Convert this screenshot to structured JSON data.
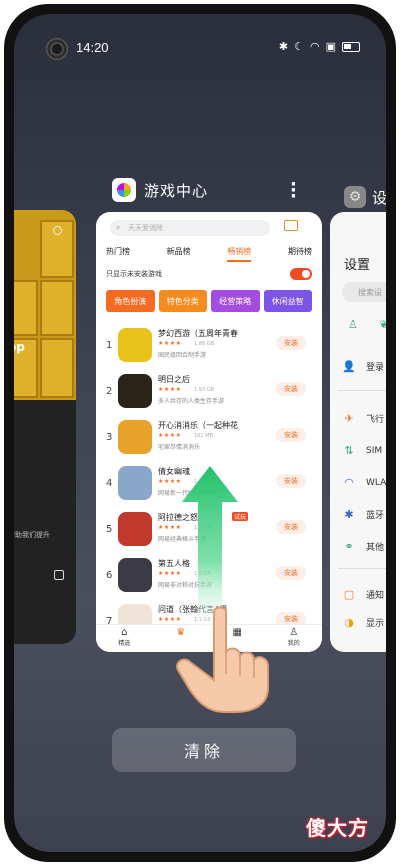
{
  "status": {
    "time": "14:20"
  },
  "left_card": {
    "text_fragment": "op",
    "caption": "帮助我们提升"
  },
  "right_card": {
    "header_title": "设",
    "title": "设置",
    "search_placeholder": "搜索设",
    "rows": [
      {
        "icon": "person",
        "label": "登录"
      },
      {
        "icon": "plane",
        "label": "飞行"
      },
      {
        "icon": "signal",
        "label": "SIM"
      },
      {
        "icon": "wifi",
        "label": "WLA"
      },
      {
        "icon": "bluetooth",
        "label": "蓝牙"
      },
      {
        "icon": "link",
        "label": "其他"
      },
      {
        "icon": "bell",
        "label": "通知"
      },
      {
        "icon": "display",
        "label": "显示"
      }
    ]
  },
  "app": {
    "title": "游戏中心",
    "search_placeholder": "天天爱消除",
    "tabs": [
      "热门榜",
      "新品榜",
      "畅销榜",
      "期待榜"
    ],
    "active_tab": 2,
    "filter_label": "只显示未安装游戏",
    "categories": [
      {
        "label": "角色扮演",
        "color": "#f46b21"
      },
      {
        "label": "特色分类",
        "color": "#f68b1f"
      },
      {
        "label": "经营策略",
        "color": "#a44be0"
      },
      {
        "label": "休闲益智",
        "color": "#7a55e8"
      }
    ],
    "games": [
      {
        "rank": "1",
        "name": "梦幻西游（五周年青春",
        "stars": "★★★★",
        "size": "1.88 GB",
        "desc": "国民级回合制手游",
        "install": "安装",
        "thumb": "#e7c21b"
      },
      {
        "rank": "2",
        "name": "明日之后",
        "stars": "★★★★",
        "size": "1.93 GB",
        "desc": "多人共存的人类生存手游",
        "install": "安装",
        "thumb": "#2b2418"
      },
      {
        "rank": "3",
        "name": "开心消消乐（一起种花",
        "stars": "★★★★",
        "size": "162 MB",
        "desc": "宅家尽情消消乐",
        "install": "安装",
        "thumb": "#e8a22a"
      },
      {
        "rank": "4",
        "name": "倩女幽魂",
        "stars": "★★★★",
        "size": "1.6 GB",
        "desc": "网易新一代MMORPG",
        "install": "安装",
        "thumb": "#8aa6c8"
      },
      {
        "rank": "5",
        "name": "阿拉德之怒",
        "stars": "★★★★",
        "size": "1.2 GB",
        "desc": "网易经典格斗手游",
        "install": "安装",
        "thumb": "#c0392b",
        "tag": "试玩"
      },
      {
        "rank": "6",
        "name": "第五人格",
        "stars": "★★★★",
        "size": "1.9 GB",
        "desc": "网易非对称对抗手游",
        "install": "安装",
        "thumb": "#3c3a44"
      },
      {
        "rank": "7",
        "name": "问道（张翰代言4周",
        "stars": "★★★★",
        "size": "1.1 GB",
        "desc": "",
        "install": "安装",
        "thumb": "#f0e4d8"
      }
    ],
    "nav": [
      "精选",
      "榜单",
      "分类",
      "我的"
    ]
  },
  "clear_label": "清除",
  "watermark": "傻大方",
  "colors": {
    "accent": "#f46b21",
    "toggle": "#f04b23",
    "arrow": "#2ecc71"
  }
}
